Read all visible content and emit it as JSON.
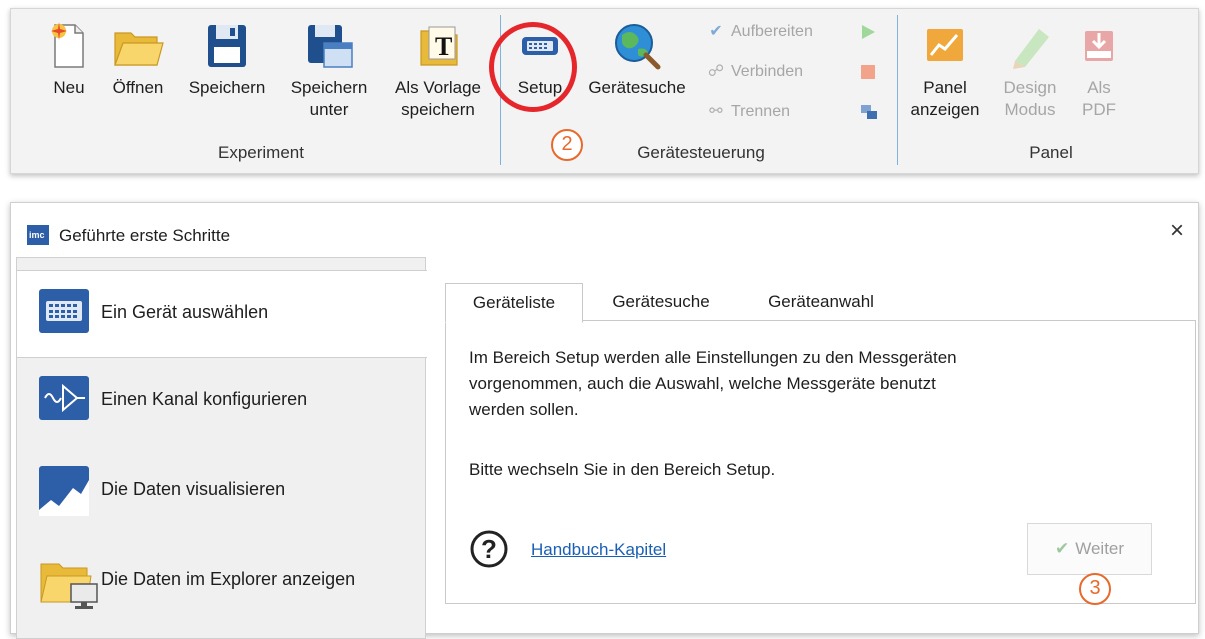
{
  "ribbon": {
    "buttons": {
      "new": "Neu",
      "open": "Öffnen",
      "save": "Speichern",
      "save_as_1": "Speichern",
      "save_as_2": "unter",
      "template_1": "Als Vorlage",
      "template_2": "speichern",
      "setup": "Setup",
      "device_search": "Gerätesuche",
      "prepare": "Aufbereiten",
      "connect": "Verbinden",
      "disconnect": "Trennen",
      "panel_show_1": "Panel",
      "panel_show_2": "anzeigen",
      "design_1": "Design",
      "design_2": "Modus",
      "pdf_1": "Als",
      "pdf_2": "PDF"
    },
    "groups": {
      "experiment": "Experiment",
      "device_control": "Gerätesteuerung",
      "panel": "Panel"
    }
  },
  "callouts": {
    "step2": "2",
    "step3": "3"
  },
  "dialog": {
    "title": "Geführte erste Schritte",
    "close": "×",
    "nav": [
      {
        "label": "Ein Gerät auswählen"
      },
      {
        "label": "Einen Kanal konfigurieren"
      },
      {
        "label": "Die Daten visualisieren"
      },
      {
        "label": "Die Daten im Explorer anzeigen"
      }
    ],
    "tabs": [
      "Geräteliste",
      "Gerätesuche",
      "Geräteanwahl"
    ],
    "body": {
      "line1": "Im Bereich Setup werden alle Einstellungen zu den Messgeräten",
      "line2": "vorgenommen, auch die Auswahl, welche Messgeräte benutzt",
      "line3": "werden sollen.",
      "line4": "Bitte wechseln Sie in den Bereich Setup."
    },
    "help_link": "Handbuch-Kapitel",
    "next_button": "Weiter"
  },
  "colors": {
    "accent": "#1a5fb4",
    "callout_red": "#e5262b",
    "callout_orange": "#e8692b"
  }
}
